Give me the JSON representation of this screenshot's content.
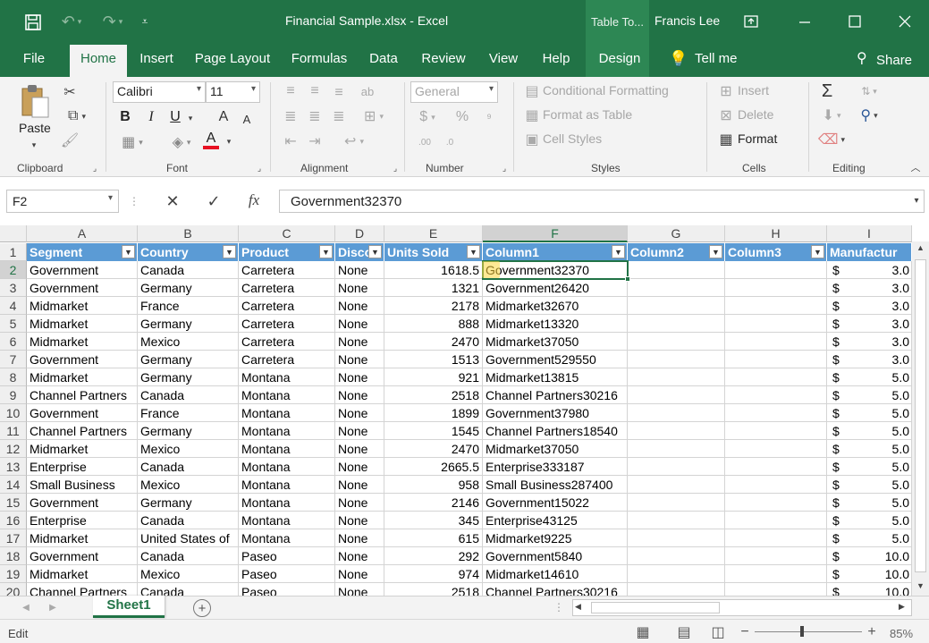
{
  "window": {
    "title": "Financial Sample.xlsx  -  Excel",
    "context_tab": "Table To...",
    "user": "Francis Lee"
  },
  "ribbon_tabs": [
    "File",
    "Home",
    "Insert",
    "Page Layout",
    "Formulas",
    "Data",
    "Review",
    "View",
    "Help",
    "Design"
  ],
  "active_tab": "Home",
  "tell_me": "Tell me",
  "share": "Share",
  "clipboard": {
    "paste": "Paste",
    "group": "Clipboard"
  },
  "font": {
    "name": "Calibri",
    "size": "11",
    "bold": "B",
    "italic": "I",
    "underline": "U",
    "grow": "A",
    "shrink": "A",
    "color_letter": "A",
    "group": "Font",
    "font_color": "#e81123"
  },
  "alignment": {
    "group": "Alignment"
  },
  "number": {
    "format": "General",
    "currency": "$",
    "percent": "%",
    "group": "Number"
  },
  "styles": {
    "conditional": "Conditional Formatting",
    "format_table": "Format as Table",
    "cell_styles": "Cell Styles",
    "group": "Styles"
  },
  "cells": {
    "insert": "Insert",
    "delete": "Delete",
    "format": "Format",
    "group": "Cells"
  },
  "editing": {
    "group": "Editing",
    "sum": "Σ"
  },
  "name_box": "F2",
  "formula": "Government32370",
  "fx": "fx",
  "columns": [
    "A",
    "B",
    "C",
    "D",
    "E",
    "F",
    "G",
    "H",
    "I"
  ],
  "table_headers": [
    "Segment",
    "Country",
    "Product",
    "Disco",
    "Units Sold",
    "Column1",
    "Column2",
    "Column3",
    "Manufactur"
  ],
  "rows": [
    {
      "n": "1"
    },
    {
      "n": "2",
      "c": [
        "Government",
        "Canada",
        "Carretera",
        "None",
        "1618.5",
        "Government32370",
        "",
        "",
        "$",
        "3.0"
      ]
    },
    {
      "n": "3",
      "c": [
        "Government",
        "Germany",
        "Carretera",
        "None",
        "1321",
        "Government26420",
        "",
        "",
        "$",
        "3.0"
      ]
    },
    {
      "n": "4",
      "c": [
        "Midmarket",
        "France",
        "Carretera",
        "None",
        "2178",
        "Midmarket32670",
        "",
        "",
        "$",
        "3.0"
      ]
    },
    {
      "n": "5",
      "c": [
        "Midmarket",
        "Germany",
        "Carretera",
        "None",
        "888",
        "Midmarket13320",
        "",
        "",
        "$",
        "3.0"
      ]
    },
    {
      "n": "6",
      "c": [
        "Midmarket",
        "Mexico",
        "Carretera",
        "None",
        "2470",
        "Midmarket37050",
        "",
        "",
        "$",
        "3.0"
      ]
    },
    {
      "n": "7",
      "c": [
        "Government",
        "Germany",
        "Carretera",
        "None",
        "1513",
        "Government529550",
        "",
        "",
        "$",
        "3.0"
      ]
    },
    {
      "n": "8",
      "c": [
        "Midmarket",
        "Germany",
        "Montana",
        "None",
        "921",
        "Midmarket13815",
        "",
        "",
        "$",
        "5.0"
      ]
    },
    {
      "n": "9",
      "c": [
        "Channel Partners",
        "Canada",
        "Montana",
        "None",
        "2518",
        "Channel Partners30216",
        "",
        "",
        "$",
        "5.0"
      ]
    },
    {
      "n": "10",
      "c": [
        "Government",
        "France",
        "Montana",
        "None",
        "1899",
        "Government37980",
        "",
        "",
        "$",
        "5.0"
      ]
    },
    {
      "n": "11",
      "c": [
        "Channel Partners",
        "Germany",
        "Montana",
        "None",
        "1545",
        "Channel Partners18540",
        "",
        "",
        "$",
        "5.0"
      ]
    },
    {
      "n": "12",
      "c": [
        "Midmarket",
        "Mexico",
        "Montana",
        "None",
        "2470",
        "Midmarket37050",
        "",
        "",
        "$",
        "5.0"
      ]
    },
    {
      "n": "13",
      "c": [
        "Enterprise",
        "Canada",
        "Montana",
        "None",
        "2665.5",
        "Enterprise333187",
        "",
        "",
        "$",
        "5.0"
      ]
    },
    {
      "n": "14",
      "c": [
        "Small Business",
        "Mexico",
        "Montana",
        "None",
        "958",
        "Small Business287400",
        "",
        "",
        "$",
        "5.0"
      ]
    },
    {
      "n": "15",
      "c": [
        "Government",
        "Germany",
        "Montana",
        "None",
        "2146",
        "Government15022",
        "",
        "",
        "$",
        "5.0"
      ]
    },
    {
      "n": "16",
      "c": [
        "Enterprise",
        "Canada",
        "Montana",
        "None",
        "345",
        "Enterprise43125",
        "",
        "",
        "$",
        "5.0"
      ]
    },
    {
      "n": "17",
      "c": [
        "Midmarket",
        "United States of",
        "Montana",
        "None",
        "615",
        "Midmarket9225",
        "",
        "",
        "$",
        "5.0"
      ]
    },
    {
      "n": "18",
      "c": [
        "Government",
        "Canada",
        "Paseo",
        "None",
        "292",
        "Government5840",
        "",
        "",
        "$",
        "10.0"
      ]
    },
    {
      "n": "19",
      "c": [
        "Midmarket",
        "Mexico",
        "Paseo",
        "None",
        "974",
        "Midmarket14610",
        "",
        "",
        "$",
        "10.0"
      ]
    },
    {
      "n": "20",
      "c": [
        "Channel Partners",
        "Canada",
        "Paseo",
        "None",
        "2518",
        "Channel Partners30216",
        "",
        "",
        "$",
        "10.0"
      ]
    }
  ],
  "sheet_tab": "Sheet1",
  "status": {
    "mode": "Edit",
    "zoom": "85%"
  },
  "colors": {
    "brand": "#217346",
    "table_header": "#5b9bd5"
  }
}
